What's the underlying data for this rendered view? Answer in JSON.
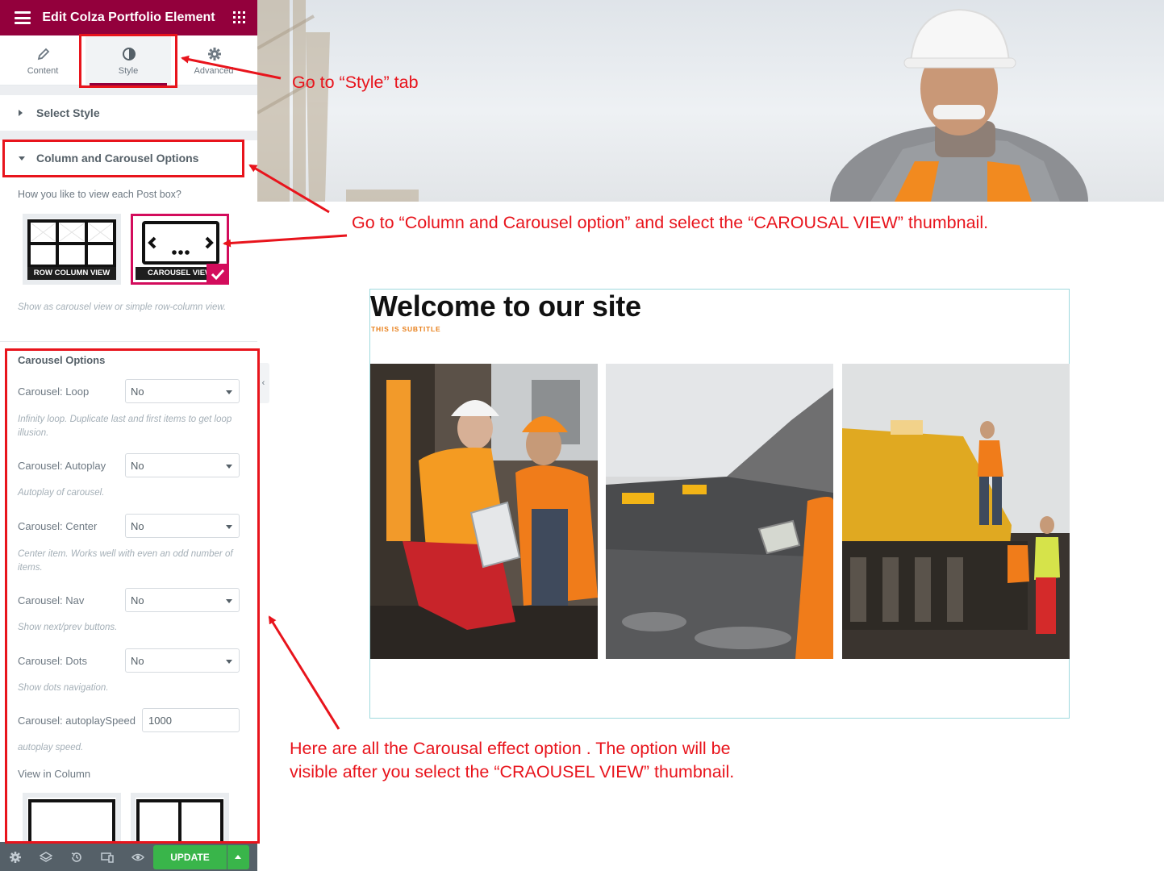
{
  "editor": {
    "title": "Edit Colza Portfolio Element",
    "tabs": [
      {
        "label": "Content",
        "icon": "pencil-icon",
        "active": false
      },
      {
        "label": "Style",
        "icon": "contrast-icon",
        "active": true
      },
      {
        "label": "Advanced",
        "icon": "gear-icon",
        "active": false
      }
    ],
    "sections": {
      "select_style": "Select Style",
      "column_carousel": "Column and Carousel Options"
    },
    "view_question": "How you like to view each Post box?",
    "thumbnails": [
      {
        "label": "ROW COLUMN VIEW",
        "selected": false
      },
      {
        "label": "CAROUSEL VIEW",
        "selected": true
      }
    ],
    "view_desc": "Show as carousel view or simple row-column view.",
    "carousel_heading": "Carousel Options",
    "controls": [
      {
        "label": "Carousel: Loop",
        "value": "No",
        "desc": "Infinity loop. Duplicate last and first items to get loop illusion."
      },
      {
        "label": "Carousel: Autoplay",
        "value": "No",
        "desc": "Autoplay of carousel."
      },
      {
        "label": "Carousel: Center",
        "value": "No",
        "desc": "Center item. Works well with even an odd number of items."
      },
      {
        "label": "Carousel: Nav",
        "value": "No",
        "desc": "Show next/prev buttons."
      },
      {
        "label": "Carousel: Dots",
        "value": "No",
        "desc": "Show dots navigation."
      }
    ],
    "speed": {
      "label": "Carousel: autoplaySpeed",
      "value": "1000",
      "desc": "autoplay speed."
    },
    "view_in_column": "View in Column",
    "footer": {
      "update": "UPDATE"
    }
  },
  "preview": {
    "title": "Welcome to our site",
    "subtitle": "THIS IS SUBTITLE"
  },
  "annotations": {
    "style_tab": "Go  to “Style” tab",
    "carousel_option": "Go to “Column and Carousel option” and select the “CAROUSAL VIEW” thumbnail.",
    "carousel_effects_line1": "Here are all the Carousal effect option . The option will be",
    "carousel_effects_line2": "visible after you select the “CRAOUSEL VIEW” thumbnail."
  },
  "colors": {
    "brand": "#93003c",
    "accent_pink": "#d30c5c",
    "annotation_red": "#e8141c",
    "update_green": "#39b54a",
    "subtitle_orange": "#e87f1a"
  }
}
